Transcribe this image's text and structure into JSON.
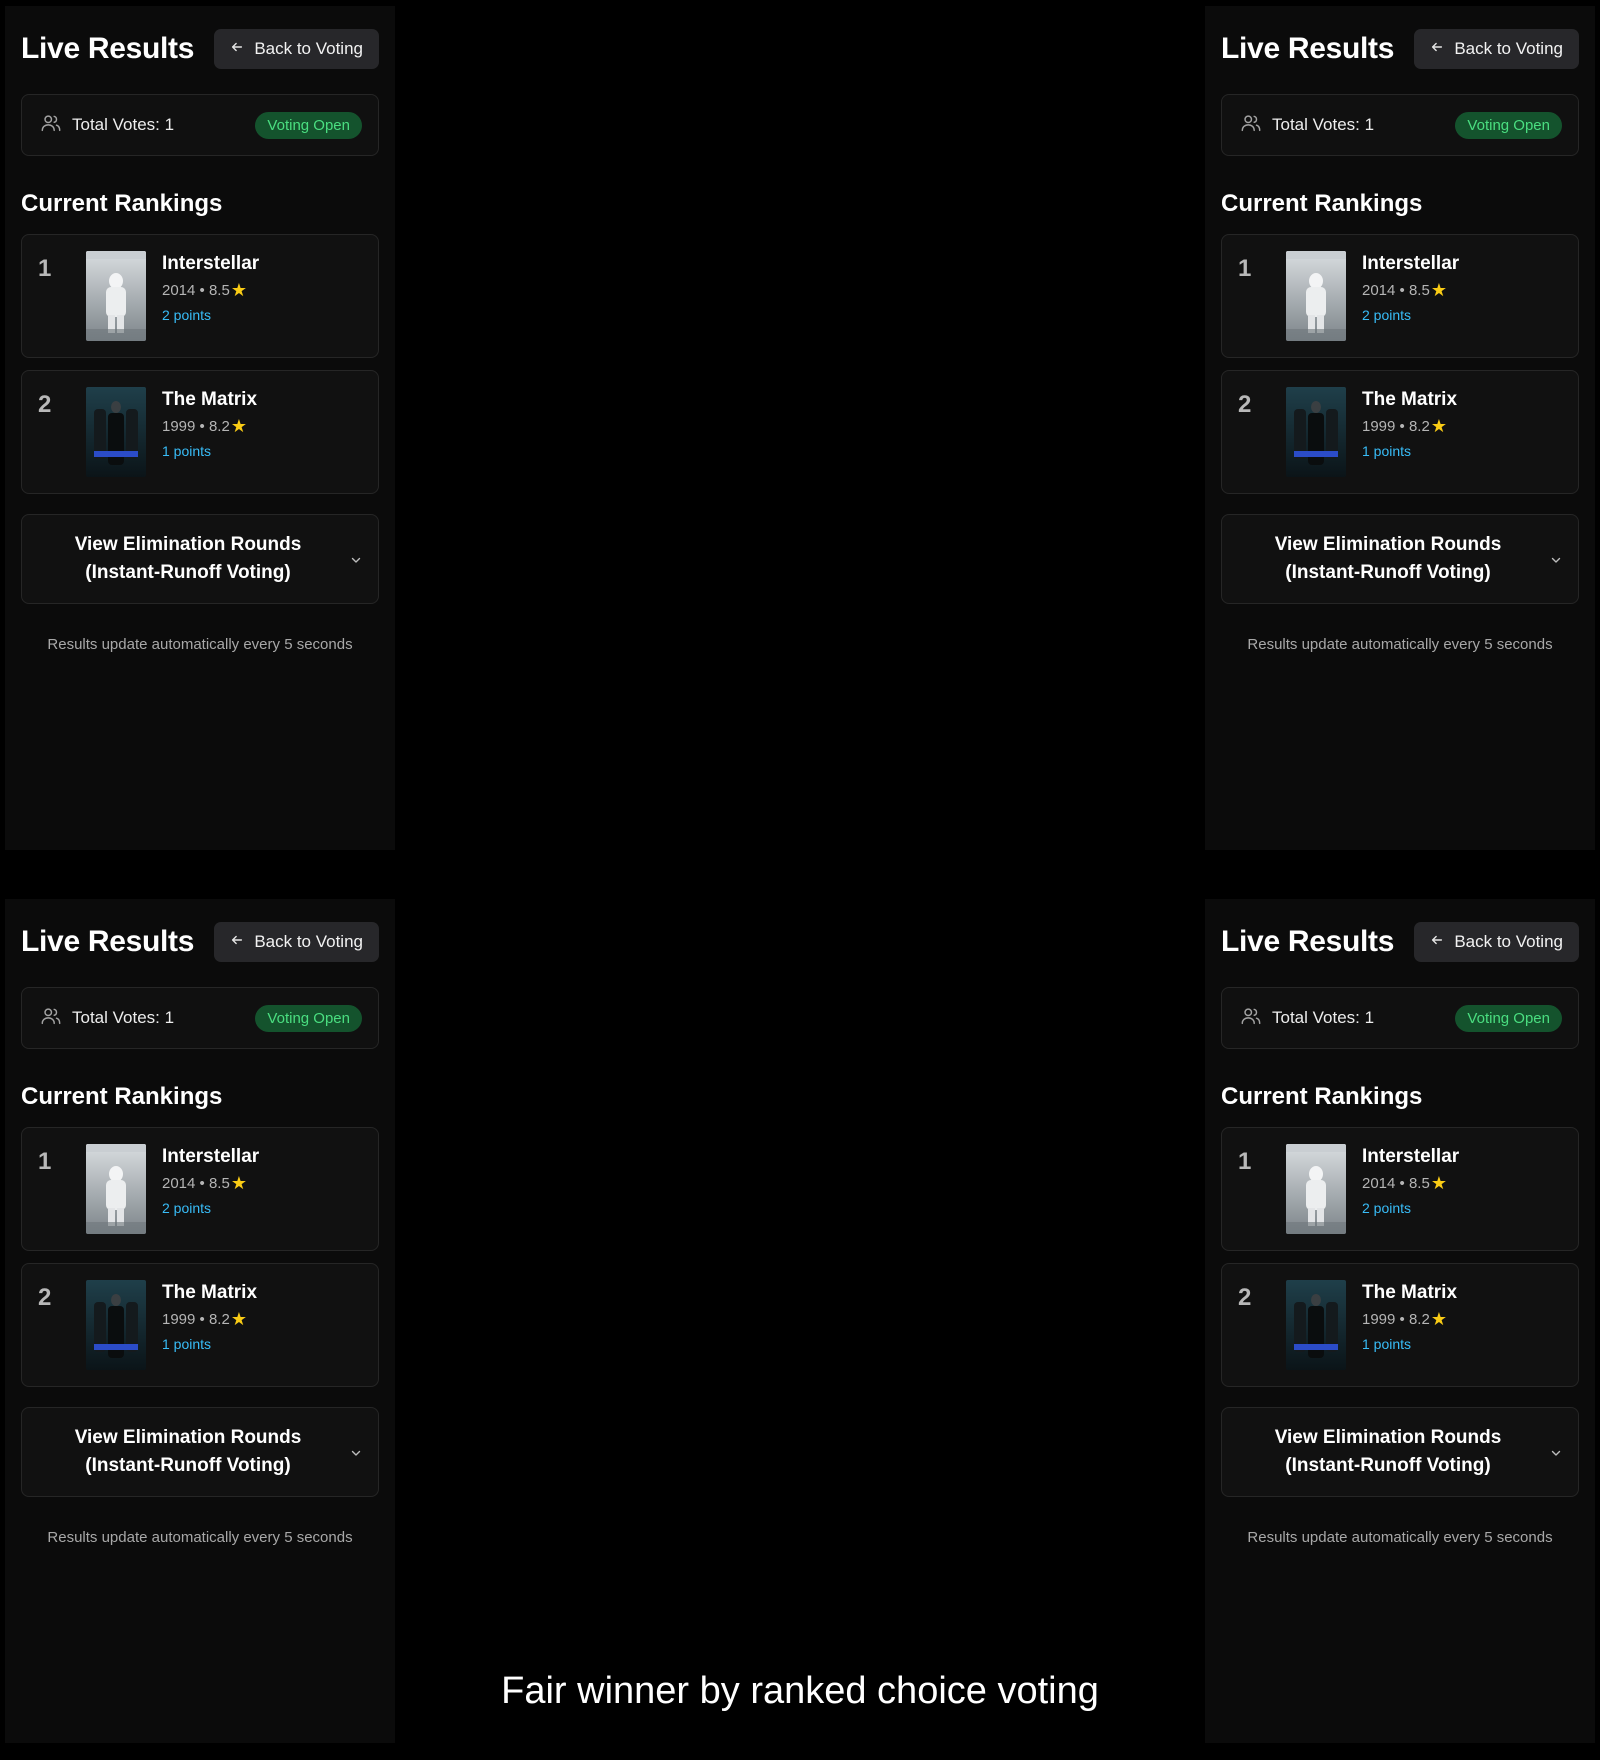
{
  "panels": [
    {
      "title": "Live Results",
      "back_label": "Back to Voting",
      "total_votes_label": "Total Votes: 1",
      "status_badge": "Voting Open",
      "rankings_title": "Current Rankings",
      "rankings": [
        {
          "rank": "1",
          "title": "Interstellar",
          "meta": "2014 • 8.5",
          "points": "2 points",
          "icon": "star-icon"
        },
        {
          "rank": "2",
          "title": "The Matrix",
          "meta": "1999 • 8.2",
          "points": "1 points",
          "icon": "star-icon"
        }
      ],
      "rounds_label": "View Elimination Rounds (Instant-Runoff Voting)",
      "footer": "Results update automatically every 5 seconds"
    },
    {
      "title": "Live Results",
      "back_label": "Back to Voting",
      "total_votes_label": "Total Votes: 1",
      "status_badge": "Voting Open",
      "rankings_title": "Current Rankings",
      "rankings": [
        {
          "rank": "1",
          "title": "Interstellar",
          "meta": "2014 • 8.5",
          "points": "2 points",
          "icon": "star-icon"
        },
        {
          "rank": "2",
          "title": "The Matrix",
          "meta": "1999 • 8.2",
          "points": "1 points",
          "icon": "star-icon"
        }
      ],
      "rounds_label": "View Elimination Rounds (Instant-Runoff Voting)",
      "footer": "Results update automatically every 5 seconds"
    },
    {
      "title": "Live Results",
      "back_label": "Back to Voting",
      "total_votes_label": "Total Votes: 1",
      "status_badge": "Voting Open",
      "rankings_title": "Current Rankings",
      "rankings": [
        {
          "rank": "1",
          "title": "Interstellar",
          "meta": "2014 • 8.5",
          "points": "2 points",
          "icon": "star-icon"
        },
        {
          "rank": "2",
          "title": "The Matrix",
          "meta": "1999 • 8.2",
          "points": "1 points",
          "icon": "star-icon"
        }
      ],
      "rounds_label": "View Elimination Rounds (Instant-Runoff Voting)",
      "footer": "Results update automatically every 5 seconds"
    },
    {
      "title": "Live Results",
      "back_label": "Back to Voting",
      "total_votes_label": "Total Votes: 1",
      "status_badge": "Voting Open",
      "rankings_title": "Current Rankings",
      "rankings": [
        {
          "rank": "1",
          "title": "Interstellar",
          "meta": "2014 • 8.5",
          "points": "2 points",
          "icon": "star-icon"
        },
        {
          "rank": "2",
          "title": "The Matrix",
          "meta": "1999 • 8.2",
          "points": "1 points",
          "icon": "star-icon"
        }
      ],
      "rounds_label": "View Elimination Rounds (Instant-Runoff Voting)",
      "footer": "Results update automatically every 5 seconds"
    }
  ],
  "caption": "Fair winner by ranked choice voting",
  "colors": {
    "background": "#000000",
    "panel": "#0b0b0b",
    "badge_bg": "#14532d",
    "badge_text": "#4ade80",
    "points": "#38bdf8",
    "star": "#facc15"
  }
}
